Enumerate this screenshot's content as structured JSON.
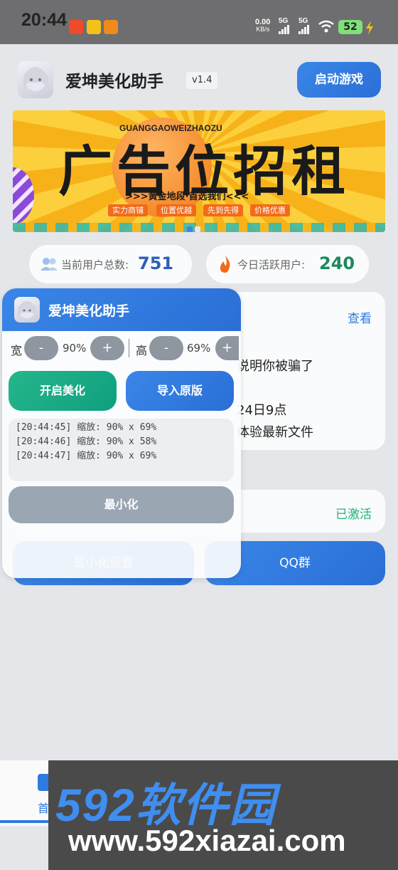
{
  "status_bar": {
    "time": "20:44",
    "net_speed": "0.00",
    "net_unit": "KB/s",
    "signal1": "5G",
    "signal2": "5G",
    "battery": "52"
  },
  "header": {
    "title": "爱坤美化助手",
    "version": "v1.4",
    "start_button": "启动游戏"
  },
  "banner": {
    "subtitle": "GUANGGAOWEIZHAOZU",
    "headline": "广告位招租",
    "tagline": ">>>黄金地段·首选我们<<<",
    "pills": [
      "实力商铺",
      "位置优越",
      "先到先得",
      "价格优惠"
    ]
  },
  "stats": {
    "total_label": "当前用户总数:",
    "total_value": "751",
    "active_label": "今日活跃用户:",
    "active_value": "240"
  },
  "notice_card": {
    "view_link": "查看",
    "line1": "说明你被骗了",
    "line2": "24日9点",
    "line3": "体验最新文件"
  },
  "activation_card": {
    "status": "已激活"
  },
  "action_buttons": {
    "left_label": "最小化设置",
    "right_label": "QQ群"
  },
  "overlay": {
    "title": "爱坤美化助手",
    "width_label": "宽",
    "width_value": "90%",
    "height_label": "高",
    "height_value": "69%",
    "minus": "-",
    "plus": "+",
    "enable_button": "开启美化",
    "import_button": "导入原版",
    "logs": [
      "[20:44:45] 缩放: 90% x 69%",
      "[20:44:46] 缩放: 90% x 58%",
      "[20:44:47] 缩放: 90% x 69%"
    ],
    "minimize_button": "最小化"
  },
  "bottom_nav": {
    "home_label": "首"
  },
  "watermark": {
    "brand": "592软件园",
    "url": "www.592xiazai.com"
  },
  "colors": {
    "primary_blue": "#2f7ae0",
    "green": "#0f9f7e",
    "stat_blue": "#2d5fb8",
    "stat_green": "#1a8a5c",
    "active_green": "#22b07a"
  }
}
